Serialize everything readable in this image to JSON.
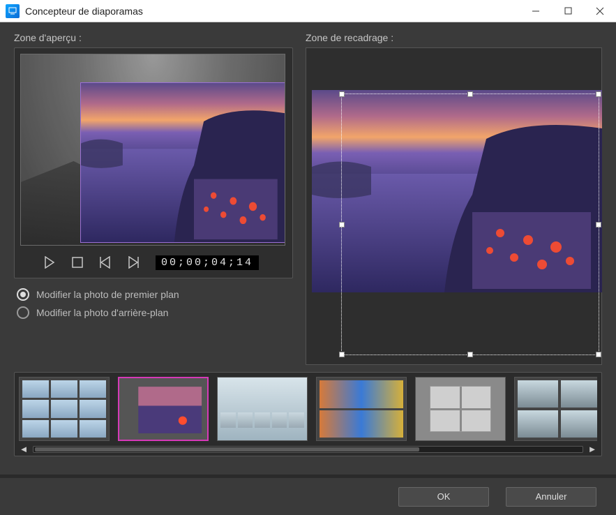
{
  "window": {
    "title": "Concepteur de diaporamas"
  },
  "labels": {
    "preview": "Zone d'aperçu :",
    "crop": "Zone de recadrage :"
  },
  "playback": {
    "timecode": "00;00;04;14"
  },
  "options": {
    "foreground": "Modifier la photo de premier plan",
    "background": "Modifier la photo d'arrière-plan",
    "selected": "foreground"
  },
  "thumbnails": [
    {
      "name": "collage-grid-3x3"
    },
    {
      "name": "sunset-village",
      "selected": true
    },
    {
      "name": "beach-filmstrip"
    },
    {
      "name": "colorful-street-mirror"
    },
    {
      "name": "framed-quad-bw"
    },
    {
      "name": "jumping-people-desert"
    }
  ],
  "buttons": {
    "ok": "OK",
    "cancel": "Annuler"
  }
}
